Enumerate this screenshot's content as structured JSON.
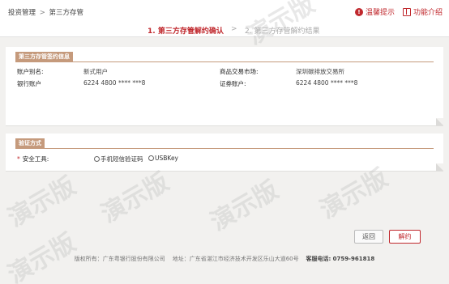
{
  "breadcrumb": {
    "item1": "投资管理",
    "sep": ">",
    "item2": "第三方存管"
  },
  "toplinks": {
    "tips": "温馨提示",
    "tips_icon": "!",
    "intro": "功能介绍"
  },
  "steps": {
    "step1": "1. 第三方存管解约确认",
    "sep": ">",
    "step2": "2. 第三方存管解约结果"
  },
  "contract_panel": {
    "title": "第三方存管签约信息",
    "account_alias_label": "账户别名:",
    "account_alias_value": "新式用户",
    "bank_account_label": "银行账户",
    "bank_account_value": "6224 4800 **** ***8",
    "market_label": "商品交易市场:",
    "market_value": "深圳碳排放交易所",
    "securities_label": "证券账户:",
    "securities_value": "6224 4800 **** ***8"
  },
  "verify_panel": {
    "title": "验证方式",
    "required_mark": "*",
    "tool_label": "安全工具:",
    "options": [
      "手机短信验证码",
      "USBKey"
    ]
  },
  "buttons": {
    "back": "返回",
    "unbind": "解约"
  },
  "footer": {
    "copyright": "版权所有：广东粤银行股份有限公司",
    "address": "地址：广东省湛江市经济技术开发区乐山大道60号",
    "hotline_label": "客服电话:",
    "hotline_value": "0759-961818"
  },
  "watermark_text": "演示版",
  "colors": {
    "accent": "#c0282d",
    "panel_title": "#c59a7c",
    "background": "#f2f1ef"
  }
}
